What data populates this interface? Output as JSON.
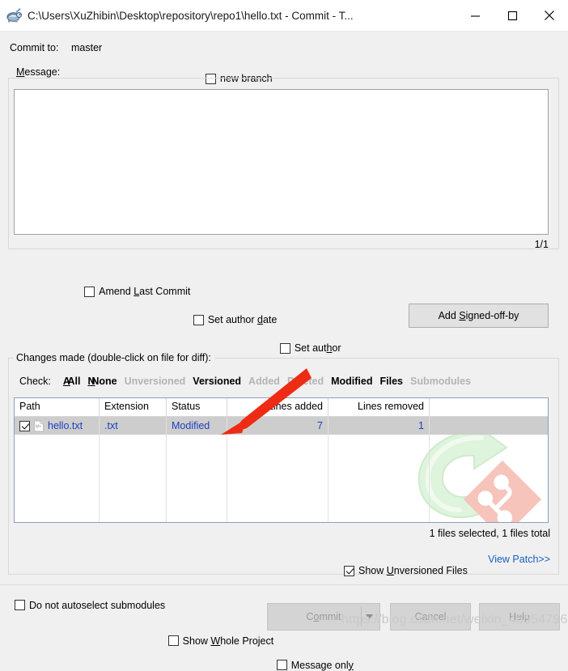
{
  "window": {
    "title": "C:\\Users\\XuZhibin\\Desktop\\repository\\repo1\\hello.txt - Commit - T...",
    "app_icon": "tortoisegit-turtle-icon",
    "minimize": "—",
    "maximize": "□",
    "close": "✕"
  },
  "commit_to": {
    "label": "Commit to:",
    "branch": "master",
    "new_branch_label": "new branch",
    "new_branch_checked": false
  },
  "message": {
    "group_label": "Message:",
    "value": "",
    "placeholder": "",
    "counter": "1/1"
  },
  "options": {
    "amend_last_commit": {
      "label_pre": "Amend ",
      "label_key": "L",
      "label_post": "ast Commit",
      "checked": false
    },
    "set_author_date": {
      "label_pre": "Set author ",
      "label_key": "d",
      "label_post": "ate",
      "checked": false
    },
    "set_author": {
      "label_pre": "Set aut",
      "label_key": "h",
      "label_post": "or",
      "checked": false
    },
    "add_signed_off_by": {
      "label_pre": "Add ",
      "label_key": "S",
      "label_post": "igned-off-by"
    }
  },
  "changes": {
    "group_label": "Changes made (double-click on file for diff):",
    "check_label": "Check:",
    "filters": [
      {
        "label": "All",
        "key": "A",
        "enabled": true
      },
      {
        "label": "None",
        "key": "N",
        "enabled": true
      },
      {
        "label": "Unversioned",
        "key": "",
        "enabled": false
      },
      {
        "label": "Versioned",
        "key": "",
        "enabled": true
      },
      {
        "label": "Added",
        "key": "",
        "enabled": false
      },
      {
        "label": "Deleted",
        "key": "",
        "enabled": false
      },
      {
        "label": "Modified",
        "key": "",
        "enabled": true
      },
      {
        "label": "Files",
        "key": "",
        "enabled": true
      },
      {
        "label": "Submodules",
        "key": "",
        "enabled": false
      }
    ],
    "columns": [
      "Path",
      "Extension",
      "Status",
      "Lines added",
      "Lines removed"
    ],
    "rows": [
      {
        "checked": true,
        "icon": "text-file-icon",
        "path": "hello.txt",
        "extension": ".txt",
        "status": "Modified",
        "lines_added": "7",
        "lines_removed": "1"
      }
    ],
    "show_unversioned_files": {
      "label_pre": "Show ",
      "label_key": "U",
      "label_post": "nversioned Files",
      "checked": true
    },
    "do_not_autoselect_submodules": {
      "label": "Do not autoselect submodules",
      "checked": false
    },
    "files_count": "1 files selected, 1 files total",
    "view_patch": "View Patch>>"
  },
  "footer": {
    "show_whole_project": {
      "label_pre": "Show ",
      "label_key": "W",
      "label_post": "hole Project",
      "checked": false
    },
    "message_only": {
      "label_pre": "Message onl",
      "label_key": "y",
      "label_post": "",
      "checked": false
    },
    "commit": {
      "label_pre": "C",
      "label_key": "o",
      "label_post": "mmit",
      "disabled": true
    },
    "cancel": "Cancel",
    "help": "Help"
  },
  "annotation": {
    "arrow_color": "#ee2b15"
  },
  "watermark": {
    "text": "https://blog.csdn.net/weixin_46554796"
  },
  "colors": {
    "link": "#1b5fbf",
    "row_text": "#1b3fbf",
    "disabled": "#b4b4b4",
    "dialog_bg": "#f0f0f0",
    "row_selected_bg": "#cdcdcd"
  }
}
